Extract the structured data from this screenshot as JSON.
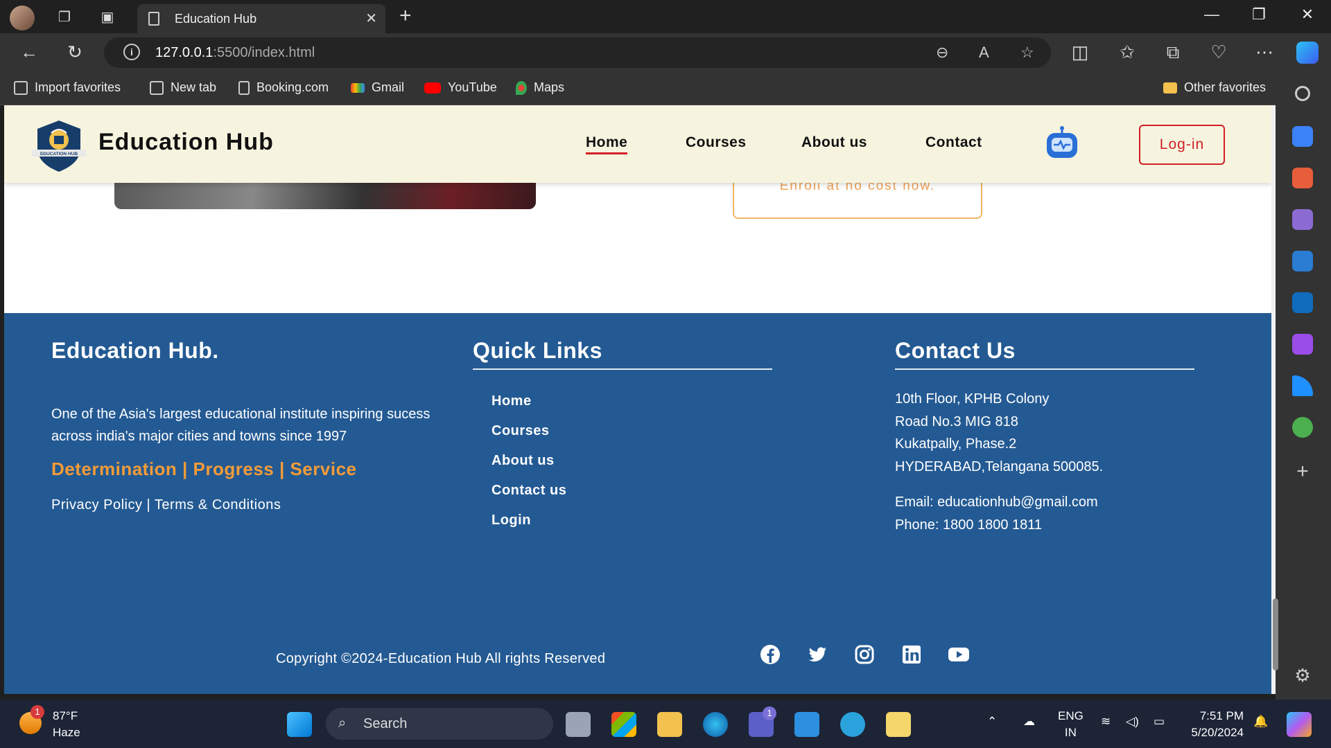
{
  "browser": {
    "tab_title": "Education Hub",
    "url_host": "127.0.0.1",
    "url_rest": ":5500/index.html",
    "favorites": [
      {
        "label": "Import favorites"
      },
      {
        "label": "New tab"
      },
      {
        "label": "Booking.com"
      },
      {
        "label": "Gmail"
      },
      {
        "label": "YouTube"
      },
      {
        "label": "Maps"
      }
    ],
    "other_favorites": "Other favorites"
  },
  "header": {
    "brand": "Education Hub",
    "logo_text": "EDUCATION HUB",
    "nav": [
      {
        "label": "Home",
        "active": true
      },
      {
        "label": "Courses"
      },
      {
        "label": "About us"
      },
      {
        "label": "Contact"
      }
    ],
    "login_label": "Log-in"
  },
  "hero": {
    "enroll_text": "Enroll at no cost now."
  },
  "footer": {
    "about": {
      "title": "Education Hub.",
      "description": "One of the Asia's largest educational institute inspiring sucess across india's major cities and towns since 1997",
      "motto": "Determination | Progress | Service",
      "policy": "Privacy Policy | Terms & Conditions"
    },
    "quick_links": {
      "title": "Quick Links",
      "items": [
        "Home",
        "Courses",
        "About us",
        "Contact us",
        "Login"
      ]
    },
    "contact": {
      "title": "Contact Us",
      "address_lines": [
        "10th Floor, KPHB Colony",
        "Road No.3 MIG 818",
        "Kukatpally, Phase.2",
        "HYDERABAD,Telangana 500085."
      ],
      "email": "Email: educationhub@gmail.com",
      "phone": "Phone: 1800 1800 1811"
    },
    "copyright": "Copyright ©2024-Education Hub All rights Reserved",
    "social": [
      "facebook",
      "twitter",
      "instagram",
      "linkedin",
      "youtube"
    ]
  },
  "taskbar": {
    "weather_temp": "87°F",
    "weather_desc": "Haze",
    "weather_badge": "1",
    "search_label": "Search",
    "teams_badge": "1",
    "lang_line1": "ENG",
    "lang_line2": "IN",
    "time": "7:51 PM",
    "date": "5/20/2024"
  },
  "colors": {
    "header_bg": "#f6f4df",
    "footer_bg": "#245a93",
    "accent_red": "#d21f26",
    "accent_orange": "#f29b38"
  }
}
